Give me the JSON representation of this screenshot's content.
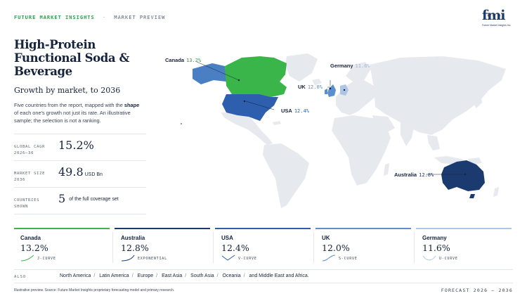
{
  "topbar": {
    "brand": "FUTURE MARKET INSIGHTS",
    "separator": "·",
    "section": "MARKET PREVIEW"
  },
  "logo": {
    "word": "fmi",
    "tagline": "Future Market Insights Inc."
  },
  "title": "High-Protein Functional Soda & Beverage",
  "subtitle": "Growth by market, to 2036",
  "description": {
    "part1": "Five countries from the report, mapped with the ",
    "bold": "shape",
    "part2": " of each one's growth not just its rate. An illustrative sample; the selection is not a ranking."
  },
  "stats": [
    {
      "label": "GLOBAL CAGR 2026–36",
      "value": "15.2%",
      "unit": ""
    },
    {
      "label": "MARKET SIZE 2036",
      "value": "49.8",
      "unit": "USD Bn"
    },
    {
      "label": "COUNTRIES SHOWN",
      "value": "5",
      "unit": "of the full coverage set"
    }
  ],
  "map_labels": [
    {
      "name": "Canada",
      "value": "13.2%",
      "color": "#2e9e4b"
    },
    {
      "name": "Germany",
      "value": "11.6%",
      "color": "#9bb8d9"
    },
    {
      "name": "UK",
      "value": "12.0%",
      "color": "#5b8fd0"
    },
    {
      "name": "USA",
      "value": "12.4%",
      "color": "#2a62b0"
    },
    {
      "name": "Australia",
      "value": "12.8%",
      "color": "#1b3a70"
    }
  ],
  "colors": {
    "land": "#e6e9ee",
    "canada": "#3ab549",
    "usa": "#2d5fae",
    "alaska": "#4a7fc4",
    "australia": "#1b3a70",
    "uk": "#5b8fd0",
    "germany": "#aec6e4",
    "accent_green": "#2e9e4b"
  },
  "tiles": [
    {
      "name": "Canada",
      "value": "13.2%",
      "curve": "J-CURVE",
      "color": "#3ab549",
      "icon": "j-curve-icon"
    },
    {
      "name": "Australia",
      "value": "12.8%",
      "curve": "EXPONENTIAL",
      "color": "#1b3a70",
      "icon": "exponential-curve-icon"
    },
    {
      "name": "USA",
      "value": "12.4%",
      "curve": "V-CURVE",
      "color": "#2d5fae",
      "icon": "v-curve-icon"
    },
    {
      "name": "UK",
      "value": "12.0%",
      "curve": "S-CURVE",
      "color": "#5b8fd0",
      "icon": "s-curve-icon"
    },
    {
      "name": "Germany",
      "value": "11.6%",
      "curve": "U-CURVE",
      "color": "#aec6e4",
      "icon": "u-curve-icon"
    }
  ],
  "also": {
    "label": "ALSO",
    "items": [
      "North America",
      "Latin America",
      "Europe",
      "East Asia",
      "South Asia",
      "Oceania",
      "and Middle East and Africa."
    ],
    "separator": "/"
  },
  "footer": {
    "source": "Illustrative preview. Source: Future Market Insights proprietary forecasting model and primary research.",
    "forecast": "FORECAST 2026 – 2036"
  }
}
